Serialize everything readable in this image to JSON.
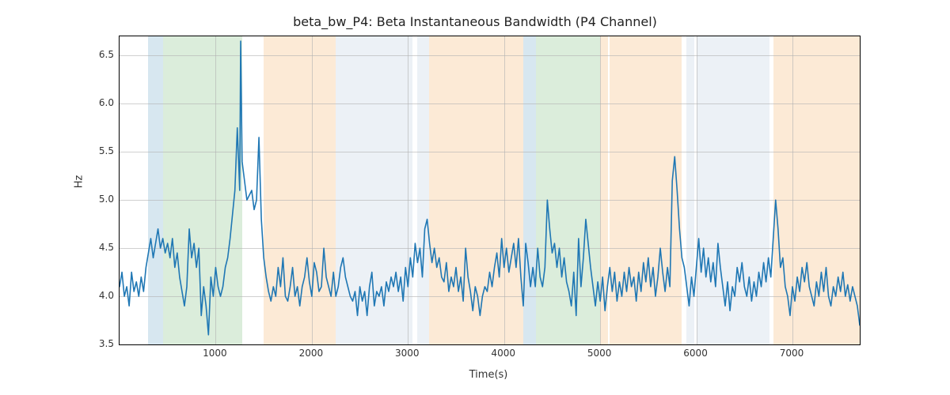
{
  "chart_data": {
    "type": "line",
    "title": "beta_bw_P4: Beta Instantaneous Bandwidth (P4 Channel)",
    "xlabel": "Time(s)",
    "ylabel": "Hz",
    "xlim": [
      0,
      7700
    ],
    "ylim": [
      3.5,
      6.7
    ],
    "x_ticks": [
      1000,
      2000,
      3000,
      4000,
      5000,
      6000,
      7000
    ],
    "y_ticks": [
      3.5,
      4.0,
      4.5,
      5.0,
      5.5,
      6.0,
      6.5
    ],
    "spans": [
      {
        "x0": 300,
        "x1": 450,
        "color": "#6fa8c9"
      },
      {
        "x0": 450,
        "x1": 1280,
        "color": "#7fbf7f"
      },
      {
        "x0": 1500,
        "x1": 2250,
        "color": "#f5b26b"
      },
      {
        "x0": 2250,
        "x1": 3050,
        "color": "#b9cde0"
      },
      {
        "x0": 3100,
        "x1": 3220,
        "color": "#b9cde0"
      },
      {
        "x0": 3220,
        "x1": 4200,
        "color": "#f5b26b"
      },
      {
        "x0": 4200,
        "x1": 4330,
        "color": "#6fa8c9"
      },
      {
        "x0": 4330,
        "x1": 5000,
        "color": "#7fbf7f"
      },
      {
        "x0": 5000,
        "x1": 5080,
        "color": "#f5b26b"
      },
      {
        "x0": 5100,
        "x1": 5850,
        "color": "#f5b26b"
      },
      {
        "x0": 5900,
        "x1": 5980,
        "color": "#b9cde0"
      },
      {
        "x0": 6000,
        "x1": 6760,
        "color": "#b9cde0"
      },
      {
        "x0": 6800,
        "x1": 6900,
        "color": "#f5b26b"
      },
      {
        "x0": 6900,
        "x1": 7700,
        "color": "#f5b26b"
      }
    ],
    "series": [
      {
        "name": "beta_bw_P4",
        "color": "#1f77b4",
        "x": [
          0,
          25,
          50,
          75,
          100,
          125,
          150,
          175,
          200,
          225,
          250,
          275,
          300,
          325,
          350,
          375,
          400,
          425,
          450,
          475,
          500,
          525,
          550,
          575,
          600,
          625,
          650,
          675,
          700,
          725,
          750,
          775,
          800,
          825,
          850,
          875,
          900,
          925,
          950,
          975,
          1000,
          1025,
          1050,
          1075,
          1100,
          1125,
          1150,
          1175,
          1200,
          1225,
          1250,
          1260,
          1275,
          1300,
          1325,
          1350,
          1375,
          1400,
          1425,
          1450,
          1475,
          1500,
          1525,
          1550,
          1575,
          1600,
          1625,
          1650,
          1675,
          1700,
          1725,
          1750,
          1775,
          1800,
          1825,
          1850,
          1875,
          1900,
          1925,
          1950,
          1975,
          2000,
          2025,
          2050,
          2075,
          2100,
          2125,
          2150,
          2175,
          2200,
          2225,
          2250,
          2275,
          2300,
          2325,
          2350,
          2375,
          2400,
          2425,
          2450,
          2475,
          2500,
          2525,
          2550,
          2575,
          2600,
          2625,
          2650,
          2675,
          2700,
          2725,
          2750,
          2775,
          2800,
          2825,
          2850,
          2875,
          2900,
          2925,
          2950,
          2975,
          3000,
          3025,
          3050,
          3075,
          3100,
          3125,
          3150,
          3175,
          3200,
          3225,
          3250,
          3275,
          3300,
          3325,
          3350,
          3375,
          3400,
          3425,
          3450,
          3475,
          3500,
          3525,
          3550,
          3575,
          3600,
          3625,
          3650,
          3675,
          3700,
          3725,
          3750,
          3775,
          3800,
          3825,
          3850,
          3875,
          3900,
          3925,
          3950,
          3975,
          4000,
          4025,
          4050,
          4075,
          4100,
          4125,
          4150,
          4175,
          4200,
          4225,
          4250,
          4275,
          4300,
          4325,
          4350,
          4375,
          4400,
          4425,
          4450,
          4475,
          4500,
          4525,
          4550,
          4575,
          4600,
          4625,
          4650,
          4675,
          4700,
          4725,
          4750,
          4775,
          4800,
          4825,
          4850,
          4875,
          4900,
          4925,
          4950,
          4975,
          5000,
          5025,
          5050,
          5075,
          5100,
          5125,
          5150,
          5175,
          5200,
          5225,
          5250,
          5275,
          5300,
          5325,
          5350,
          5375,
          5400,
          5425,
          5450,
          5475,
          5500,
          5525,
          5550,
          5575,
          5600,
          5625,
          5650,
          5675,
          5700,
          5725,
          5750,
          5775,
          5800,
          5825,
          5850,
          5875,
          5900,
          5925,
          5950,
          5975,
          6000,
          6025,
          6050,
          6075,
          6100,
          6125,
          6150,
          6175,
          6200,
          6225,
          6250,
          6275,
          6300,
          6325,
          6350,
          6375,
          6400,
          6425,
          6450,
          6475,
          6500,
          6525,
          6550,
          6575,
          6600,
          6625,
          6650,
          6675,
          6700,
          6725,
          6750,
          6775,
          6800,
          6825,
          6850,
          6875,
          6900,
          6925,
          6950,
          6975,
          7000,
          7025,
          7050,
          7075,
          7100,
          7125,
          7150,
          7175,
          7200,
          7225,
          7250,
          7275,
          7300,
          7325,
          7350,
          7375,
          7400,
          7425,
          7450,
          7475,
          7500,
          7525,
          7550,
          7575,
          7600,
          7625,
          7650,
          7675,
          7700
        ],
        "y": [
          4.1,
          4.25,
          4.0,
          4.1,
          3.9,
          4.25,
          4.05,
          4.15,
          4.0,
          4.2,
          4.05,
          4.3,
          4.45,
          4.6,
          4.4,
          4.55,
          4.7,
          4.5,
          4.6,
          4.45,
          4.55,
          4.4,
          4.6,
          4.3,
          4.45,
          4.2,
          4.05,
          3.9,
          4.1,
          4.7,
          4.4,
          4.55,
          4.3,
          4.5,
          3.8,
          4.1,
          3.9,
          3.6,
          4.2,
          4.0,
          4.3,
          4.1,
          4.0,
          4.1,
          4.3,
          4.4,
          4.6,
          4.85,
          5.1,
          5.75,
          5.1,
          6.65,
          5.4,
          5.2,
          5.0,
          5.05,
          5.1,
          4.9,
          5.0,
          5.65,
          4.8,
          4.4,
          4.2,
          4.05,
          3.95,
          4.1,
          4.0,
          4.3,
          4.1,
          4.4,
          4.0,
          3.95,
          4.1,
          4.3,
          4.0,
          4.1,
          3.9,
          4.1,
          4.2,
          4.4,
          4.15,
          4.0,
          4.35,
          4.25,
          4.05,
          4.1,
          4.5,
          4.2,
          4.1,
          4.0,
          4.25,
          4.0,
          4.1,
          4.3,
          4.4,
          4.2,
          4.1,
          4.0,
          3.95,
          4.05,
          3.8,
          4.1,
          3.95,
          4.05,
          3.8,
          4.1,
          4.25,
          3.9,
          4.05,
          4.0,
          4.1,
          3.9,
          4.15,
          4.05,
          4.2,
          4.1,
          4.25,
          4.05,
          4.2,
          3.95,
          4.3,
          4.1,
          4.4,
          4.2,
          4.55,
          4.35,
          4.5,
          4.2,
          4.7,
          4.8,
          4.55,
          4.35,
          4.5,
          4.3,
          4.4,
          4.2,
          4.15,
          4.35,
          4.05,
          4.2,
          4.1,
          4.3,
          4.05,
          4.2,
          3.95,
          4.5,
          4.2,
          4.05,
          3.85,
          4.1,
          4.0,
          3.8,
          4.0,
          4.1,
          4.05,
          4.25,
          4.1,
          4.3,
          4.45,
          4.2,
          4.6,
          4.3,
          4.5,
          4.25,
          4.4,
          4.55,
          4.3,
          4.6,
          4.2,
          3.9,
          4.55,
          4.35,
          4.1,
          4.3,
          4.1,
          4.5,
          4.2,
          4.1,
          4.3,
          5.0,
          4.7,
          4.45,
          4.55,
          4.3,
          4.5,
          4.2,
          4.4,
          4.15,
          4.05,
          3.9,
          4.25,
          3.8,
          4.6,
          4.1,
          4.4,
          4.8,
          4.55,
          4.3,
          4.1,
          3.9,
          4.15,
          3.95,
          4.2,
          3.85,
          4.1,
          4.3,
          4.05,
          4.25,
          3.95,
          4.15,
          4.0,
          4.25,
          4.05,
          4.3,
          4.1,
          4.2,
          3.95,
          4.25,
          4.05,
          4.35,
          4.15,
          4.4,
          4.1,
          4.3,
          4.0,
          4.2,
          4.5,
          4.25,
          4.05,
          4.3,
          4.1,
          5.2,
          5.45,
          5.1,
          4.7,
          4.4,
          4.3,
          4.1,
          3.9,
          4.2,
          4.0,
          4.3,
          4.6,
          4.25,
          4.5,
          4.2,
          4.4,
          4.15,
          4.35,
          4.1,
          4.55,
          4.3,
          4.1,
          3.9,
          4.15,
          3.85,
          4.1,
          4.0,
          4.3,
          4.15,
          4.35,
          4.1,
          4.0,
          4.2,
          3.95,
          4.15,
          4.0,
          4.25,
          4.1,
          4.35,
          4.15,
          4.4,
          4.2,
          4.6,
          5.0,
          4.7,
          4.3,
          4.4,
          4.1,
          4.0,
          3.8,
          4.1,
          3.95,
          4.2,
          4.05,
          4.3,
          4.15,
          4.35,
          4.1,
          4.0,
          3.9,
          4.15,
          4.0,
          4.25,
          4.05,
          4.3,
          4.0,
          3.9,
          4.1,
          4.0,
          4.2,
          4.05,
          4.25,
          4.0,
          4.12,
          3.95,
          4.1,
          4.0,
          3.9,
          3.7
        ]
      }
    ]
  }
}
